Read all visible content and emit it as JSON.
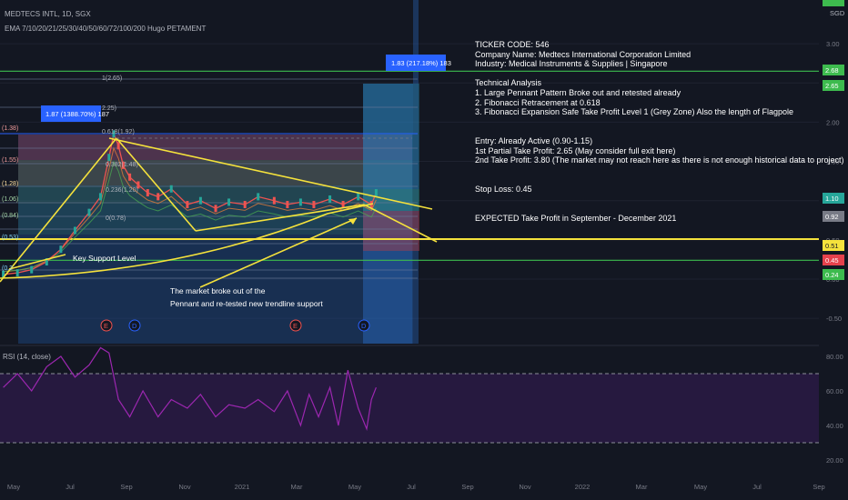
{
  "header": {
    "symbol_line": "MEDTECS INTL, 1D, SGX",
    "indicator_line": "EMA 7/10/20/21/25/30/40/50/60/72/100/200 Hugo PETAMENT"
  },
  "currency_label": "SGD",
  "colors": {
    "background": "#131722",
    "grid": "#1e2230",
    "yellow": "#f5e23c",
    "green": "#3dbb4e",
    "red": "#e5414c",
    "blue": "#2962ff",
    "rsi_line": "#9c27b0",
    "rsi_band": "#2a1a44"
  },
  "measure_labels": {
    "left": "1.87 (1388.70%) 187",
    "right": "1.83 (217.18%) 183"
  },
  "fib_labels": [
    "1(2.65)",
    "0.618(1.92)",
    "0.382(1.48)",
    "0.236(1.20)",
    "0(0.78)",
    "(1.38)",
    "(1.55)",
    "(1.28)",
    "(1.06)",
    "(0.84)",
    "(0.53)",
    "(0.2",
    "2.25)"
  ],
  "annotations": {
    "support_label": "Key Support Level",
    "breakout_note_1": "The market broke out of the",
    "breakout_note_2": "Pennant and re-tested new trendline support"
  },
  "analysis_lines": [
    "TICKER CODE: 546",
    "Company Name: Medtecs International Corporation Limited",
    "Industry: Medical Instruments & Supplies | Singapore",
    "",
    "Technical Analysis",
    "1. Large Pennant Pattern Broke out and retested already",
    "2. Fibonacci Retracement at 0.618",
    "3. Fibonacci Expansion Safe Take Profit Level 1 (Grey Zone) Also the length of Flagpole",
    "",
    "",
    "Entry: Already Active (0.90-1.15)",
    "1st Partial Take Profit: 2.65 (May consider full exit here)",
    "2nd Take Profit: 3.80 (The market may not reach here as there is not enough historical data to project)",
    "",
    "",
    "Stop Loss: 0.45",
    "",
    "",
    "EXPECTED Take Profit in September - December 2021"
  ],
  "event_markers": [
    "E",
    "D",
    "E",
    "D"
  ],
  "rsi_label": "RSI (14, close)",
  "chart_data": [
    {
      "type": "line",
      "title": "",
      "x_ticks": [
        "May",
        "Jul",
        "Sep",
        "Nov",
        "2021",
        "Mar",
        "May",
        "Jul",
        "Sep",
        "Nov",
        "2022",
        "Mar",
        "May",
        "Jul",
        "Sep"
      ],
      "y_ticks": [
        3.0,
        2.5,
        2.0,
        1.5,
        1.0,
        0.5,
        0.0,
        -0.5
      ],
      "ylim": [
        -0.65,
        3.15
      ],
      "price_badges": [
        {
          "value": "2.68",
          "color": "#3dbb4e"
        },
        {
          "value": "2.65",
          "color": "#3dbb4e"
        },
        {
          "value": "1.10",
          "color": "#26a69a"
        },
        {
          "value": "0.92",
          "color": "#787b86"
        },
        {
          "value": "0.51",
          "color": "#f5e23c"
        },
        {
          "value": "0.45",
          "color": "#e5414c"
        },
        {
          "value": "0.24",
          "color": "#3dbb4e"
        }
      ],
      "horizontal_levels": [
        {
          "value": 2.65,
          "color": "green"
        },
        {
          "value": 0.51,
          "color": "yellow"
        },
        {
          "value": 0.24,
          "color": "green"
        }
      ],
      "series": [
        {
          "x": [
            "2020-04-20",
            "2020-05-05",
            "2020-05-20",
            "2020-06-05",
            "2020-06-20",
            "2020-07-05",
            "2020-07-20",
            "2020-08-01",
            "2020-08-10",
            "2020-08-15",
            "2020-08-20",
            "2020-08-25",
            "2020-09-01",
            "2020-09-10",
            "2020-09-20",
            "2020-10-01",
            "2020-10-15",
            "2020-11-01",
            "2020-11-15",
            "2020-12-01",
            "2020-12-15",
            "2021-01-01",
            "2021-01-15",
            "2021-02-01",
            "2021-02-15",
            "2021-03-01",
            "2021-03-15",
            "2021-04-01",
            "2021-04-15",
            "2021-05-01",
            "2021-05-15",
            "2021-05-20"
          ],
          "values": [
            0.06,
            0.08,
            0.12,
            0.22,
            0.38,
            0.62,
            0.85,
            1.05,
            1.55,
            1.85,
            1.7,
            1.45,
            1.3,
            1.2,
            1.1,
            1.05,
            1.15,
            0.95,
            1.0,
            0.9,
            0.98,
            0.95,
            1.05,
            1.0,
            0.95,
            0.98,
            0.95,
            1.02,
            0.95,
            1.05,
            0.95,
            1.1
          ]
        }
      ]
    },
    {
      "type": "line",
      "title": "RSI (14, close)",
      "y_ticks": [
        80.0,
        60.0,
        40.0,
        20.0
      ],
      "ylim": [
        15,
        88
      ],
      "bands": [
        70,
        30
      ],
      "series": [
        {
          "x": [
            "2020-04-20",
            "2020-05-05",
            "2020-05-20",
            "2020-06-05",
            "2020-06-20",
            "2020-07-05",
            "2020-07-20",
            "2020-08-01",
            "2020-08-10",
            "2020-08-20",
            "2020-09-01",
            "2020-09-15",
            "2020-10-01",
            "2020-10-15",
            "2020-11-01",
            "2020-11-15",
            "2020-12-01",
            "2020-12-15",
            "2021-01-01",
            "2021-01-15",
            "2021-02-01",
            "2021-02-15",
            "2021-03-01",
            "2021-03-10",
            "2021-03-20",
            "2021-04-01",
            "2021-04-10",
            "2021-04-20",
            "2021-05-01",
            "2021-05-10",
            "2021-05-15",
            "2021-05-20"
          ],
          "values": [
            62,
            70,
            60,
            74,
            80,
            68,
            75,
            85,
            82,
            55,
            45,
            60,
            45,
            55,
            50,
            58,
            45,
            52,
            50,
            55,
            48,
            60,
            40,
            58,
            45,
            62,
            40,
            72,
            50,
            38,
            55,
            62
          ]
        }
      ]
    }
  ]
}
